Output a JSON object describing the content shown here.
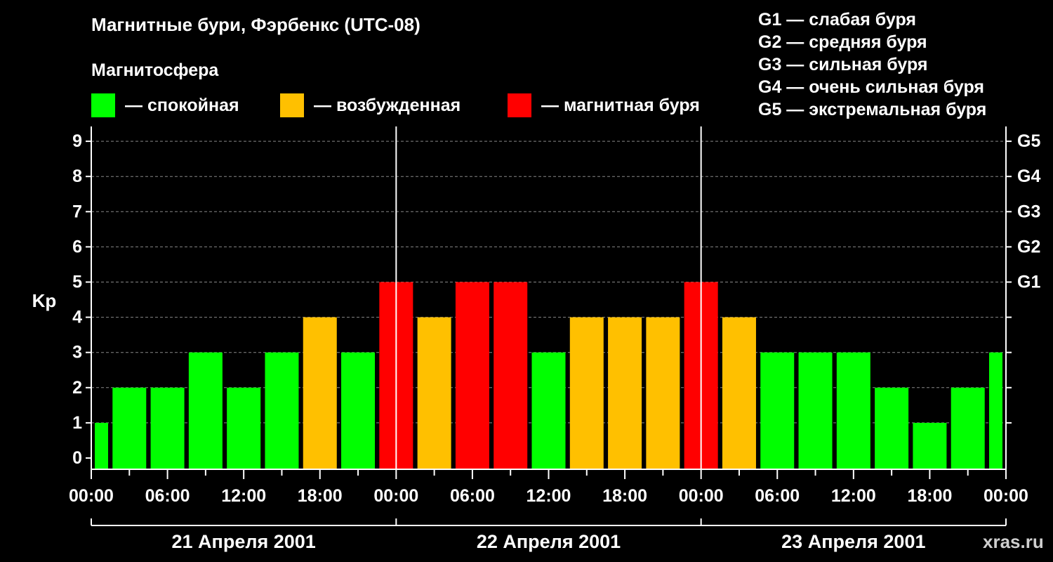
{
  "title": "Магнитные бури, Фэрбенкс (UTC-08)",
  "legend": {
    "heading": "Магнитосфера",
    "items": [
      {
        "label": "— спокойная",
        "color": "#00ff00"
      },
      {
        "label": "— возбужденная",
        "color": "#ffc000"
      },
      {
        "label": "— магнитная буря",
        "color": "#ff0000"
      }
    ]
  },
  "g_scale": [
    "G1 — слабая буря",
    "G2 — средняя буря",
    "G3 — сильная буря",
    "G4 — очень сильная буря",
    "G5 — экстремальная буря"
  ],
  "watermark": "xras.ru",
  "chart_data": {
    "type": "bar",
    "ylabel": "Kp",
    "ylim": [
      0,
      9
    ],
    "y_ticks": [
      "0",
      "1",
      "2",
      "3",
      "4",
      "5",
      "6",
      "7",
      "8",
      "9"
    ],
    "right_ticks": [
      {
        "value": 5,
        "label": "G1"
      },
      {
        "value": 6,
        "label": "G2"
      },
      {
        "value": 7,
        "label": "G3"
      },
      {
        "value": 8,
        "label": "G4"
      },
      {
        "value": 9,
        "label": "G5"
      }
    ],
    "x_tick_labels": [
      "00:00",
      "06:00",
      "12:00",
      "18:00",
      "00:00",
      "06:00",
      "12:00",
      "18:00",
      "00:00",
      "06:00",
      "12:00",
      "18:00",
      "00:00"
    ],
    "days": [
      "21 Апреля 2001",
      "22 Апреля 2001",
      "23 Апреля 2001"
    ],
    "grid": true,
    "colors": {
      "quiet": "#00ff00",
      "active": "#ffc000",
      "storm": "#ff0000"
    },
    "values": [
      1,
      2,
      2,
      3,
      2,
      3,
      4,
      3,
      5,
      4,
      5,
      5,
      3,
      4,
      4,
      4,
      5,
      4,
      3,
      3,
      3,
      2,
      1,
      2,
      3
    ]
  }
}
